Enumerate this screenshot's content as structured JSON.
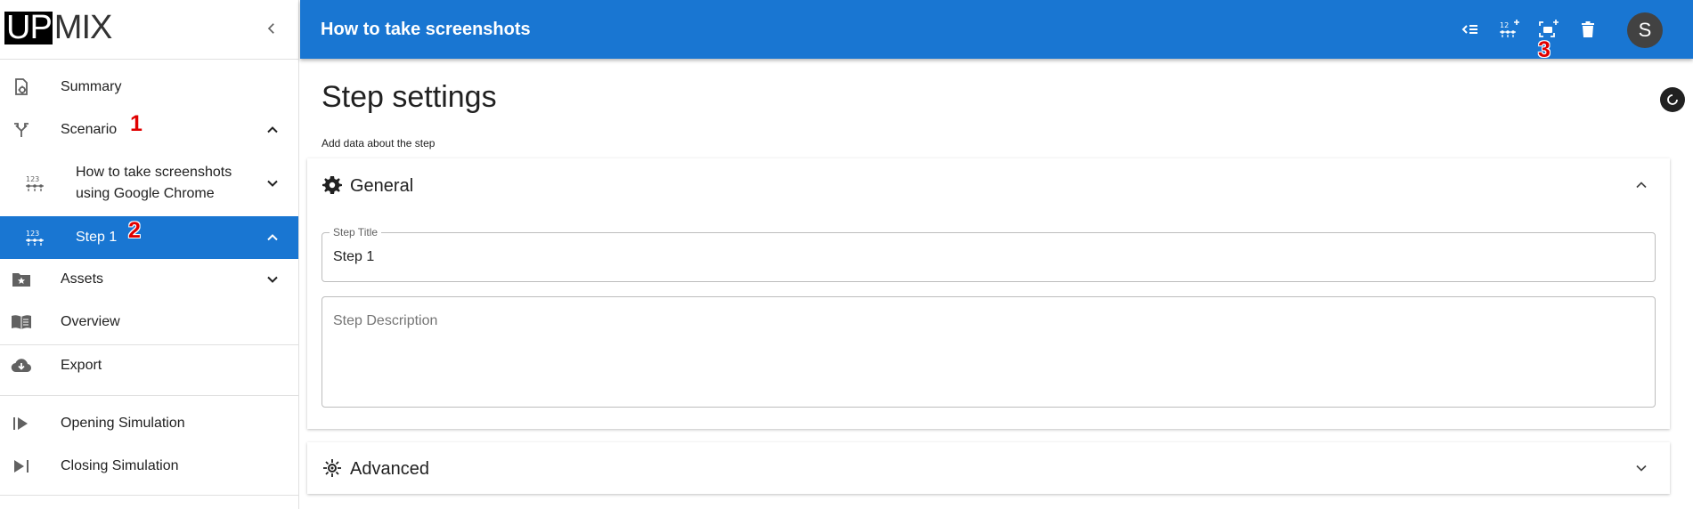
{
  "logo": {
    "part1": "UP",
    "part2": "MIX"
  },
  "sidebar": {
    "items": [
      {
        "label": "Summary",
        "icon": "summary-settings-icon"
      },
      {
        "label": "Scenario",
        "icon": "fork-arrows-icon"
      },
      {
        "label": "How to take screenshots using Google Chrome",
        "icon": "numbered-steps-icon"
      },
      {
        "label": "Step 1",
        "icon": "numbered-steps-icon"
      },
      {
        "label": "Assets",
        "icon": "folder-star-icon"
      },
      {
        "label": "Overview",
        "icon": "open-book-icon"
      },
      {
        "label": "Export",
        "icon": "cloud-download-icon"
      },
      {
        "label": "Opening Simulation",
        "icon": "play-start-icon"
      },
      {
        "label": "Closing Simulation",
        "icon": "skip-end-icon"
      }
    ]
  },
  "annotations": {
    "marker1": "1",
    "marker2": "2",
    "marker3": "3"
  },
  "topbar": {
    "title": "How to take screenshots",
    "avatar_letter": "S"
  },
  "main": {
    "title": "Step settings",
    "subtitle": "Add data about the step",
    "general": {
      "title": "General",
      "step_title_label": "Step Title",
      "step_title_value": "Step 1",
      "step_description_placeholder": "Step Description"
    },
    "advanced": {
      "title": "Advanced"
    }
  },
  "colors": {
    "accent": "#1976d2",
    "marker": "#e00000",
    "avatar": "#424242"
  }
}
